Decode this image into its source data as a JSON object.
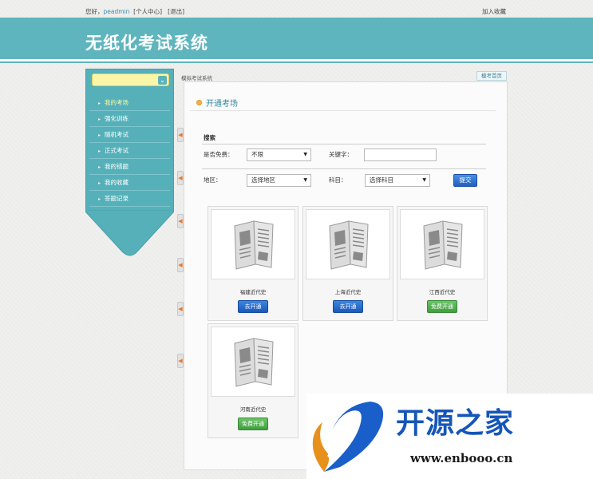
{
  "topbar": {
    "greeting": "您好，",
    "username": "peadmin",
    "profile_link": "[个人中心]",
    "logout_link": "[退出]",
    "favorite_link": "加入收藏"
  },
  "header": {
    "title": "无纸化考试系统"
  },
  "sidebar": {
    "dropdown_icon": "chevron-down-icon",
    "items": [
      {
        "label": "我的考场",
        "active": true
      },
      {
        "label": "强化训练",
        "active": false
      },
      {
        "label": "随机考试",
        "active": false
      },
      {
        "label": "正式考试",
        "active": false
      },
      {
        "label": "我的错题",
        "active": false
      },
      {
        "label": "我的收藏",
        "active": false
      },
      {
        "label": "答题记录",
        "active": false
      }
    ]
  },
  "breadcrumb": "模拟考试系统",
  "home_button": "模考首页",
  "section_title": "开通考场",
  "search": {
    "heading": "搜索",
    "free_label": "是否免费：",
    "free_value": "不限",
    "keyword_label": "关键字：",
    "keyword_value": "",
    "region_label": "地区：",
    "region_value": "选择地区",
    "subject_label": "科目：",
    "subject_value": "选择科目",
    "submit_label": "提交"
  },
  "cards": [
    {
      "name": "福建近代史",
      "button": "去开通",
      "style": "blue"
    },
    {
      "name": "上海近代史",
      "button": "去开通",
      "style": "blue"
    },
    {
      "name": "江西近代史",
      "button": "免费开通",
      "style": "green"
    },
    {
      "name": "河南近代史",
      "button": "免费开通",
      "style": "green"
    }
  ],
  "watermark": {
    "text": "开源之家",
    "url": "www.enbooo.cn"
  },
  "colors": {
    "header": "#5fb5bd",
    "sidebar": "#55b0b9",
    "accent_blue": "#1a58bd",
    "accent_green": "#3f9e3e"
  }
}
